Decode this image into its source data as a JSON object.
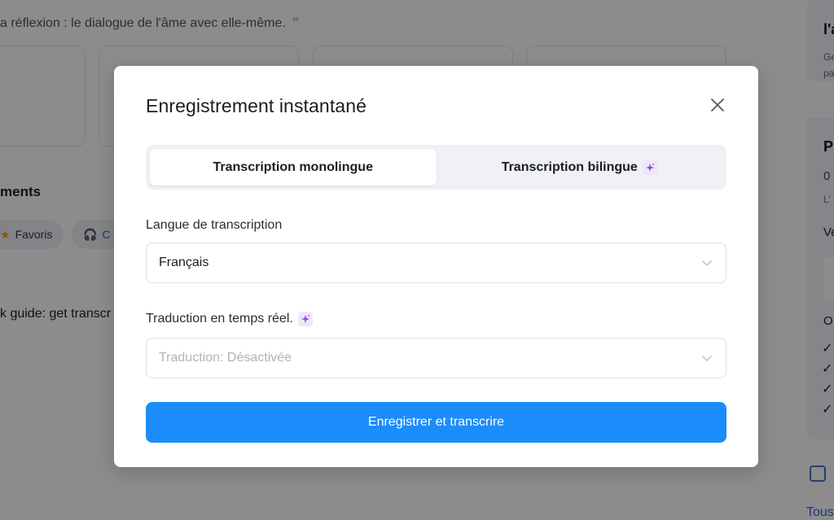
{
  "background": {
    "quote_text": "a réflexion : le dialogue de l'âme avec elle-même.",
    "quote_mark": "❞",
    "section_title": "ments",
    "chip_favoris": "Favoris",
    "chip_other": "C",
    "guide_text": "k guide: get transcr",
    "right_title_1": "l'a",
    "right_text_1a": "Ge",
    "right_text_1b": "pa",
    "right_title_2": "P",
    "right_text_2": "0",
    "right_text_3": "L'",
    "right_text_4": "Ve",
    "right_text_5": "O",
    "right_checks": [
      "✓",
      "✓",
      "✓",
      "✓"
    ],
    "right_link": "Tous"
  },
  "modal": {
    "title": "Enregistrement instantané",
    "tabs": [
      {
        "label": "Transcription monolingue",
        "active": true
      },
      {
        "label": "Transcription bilingue",
        "active": false
      }
    ],
    "language_label": "Langue de transcription",
    "language_value": "Français",
    "translation_label": "Traduction en temps réel.",
    "translation_placeholder": "Traduction: Désactivée",
    "submit_label": "Enregistrer et transcrire"
  },
  "colors": {
    "primary": "#1c8cfb",
    "overlay": "rgba(0,0,0,0.45)",
    "sparkle_bg": "#ece8f7"
  },
  "icons": {
    "close": "close-icon",
    "chevron": "chevron-down-icon",
    "sparkle": "sparkle-icon"
  }
}
